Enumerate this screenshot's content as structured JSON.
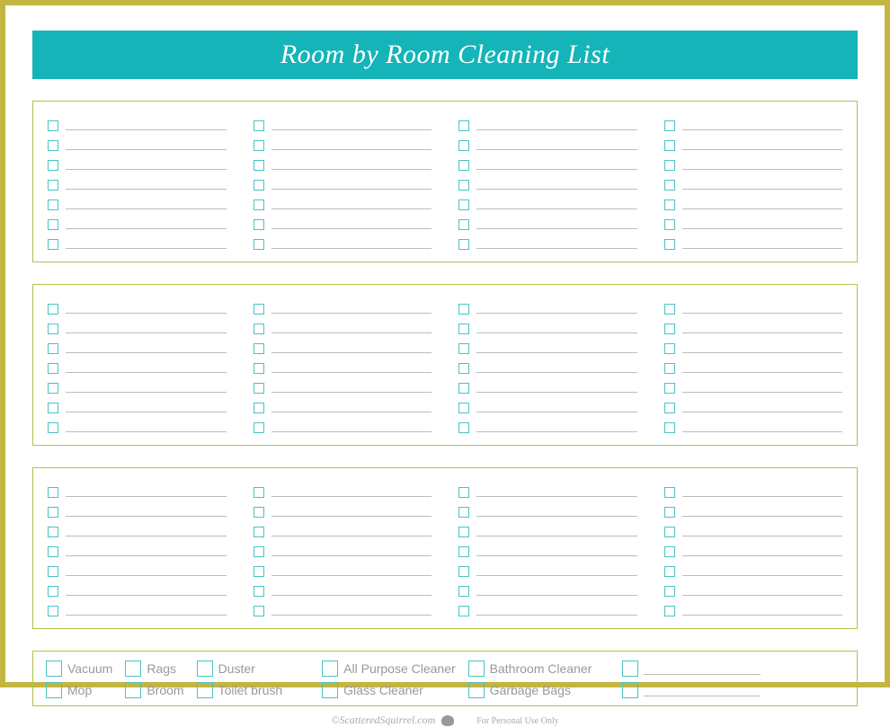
{
  "title": "Room by Room Cleaning List",
  "sections": {
    "count": 3,
    "columns_per_section": 4,
    "rows_per_column": 7
  },
  "supplies": {
    "col1": [
      "Vacuum",
      "Mop"
    ],
    "col2": [
      "Rags",
      "Broom"
    ],
    "col3": [
      "Duster",
      "Toilet brush"
    ],
    "col4": [
      "All Purpose Cleaner",
      "Glass Cleaner"
    ],
    "col5": [
      "Bathroom Cleaner",
      "Garbage Bags"
    ],
    "blank_lines": 2
  },
  "footer": {
    "credit": "©ScatteredSquirrel.com",
    "note": "For Personal Use Only"
  }
}
